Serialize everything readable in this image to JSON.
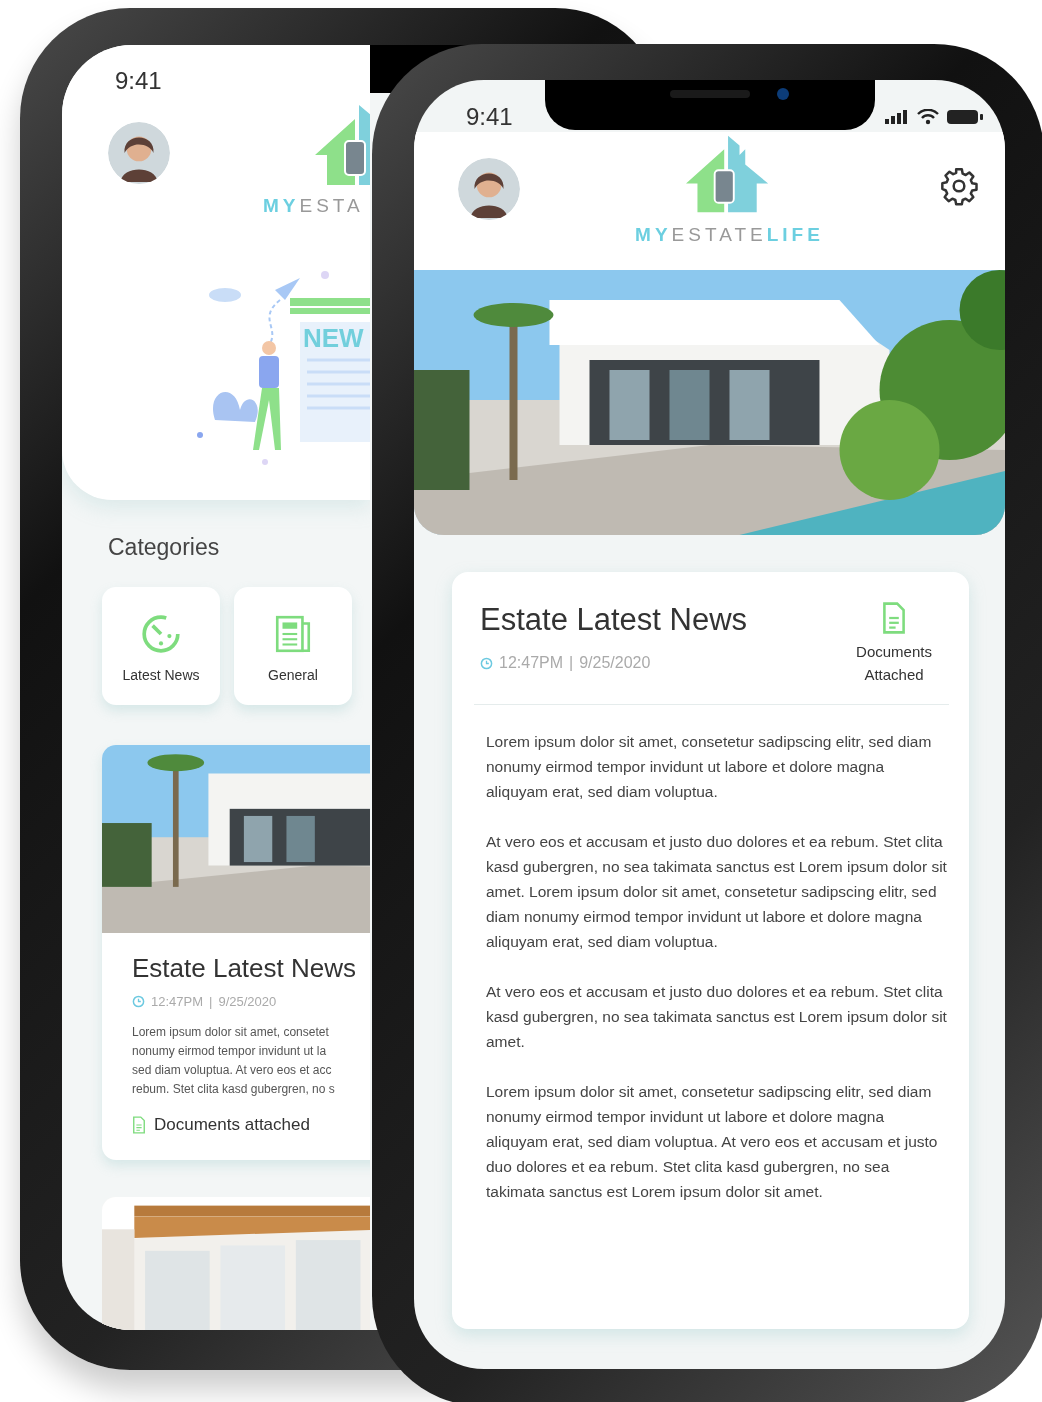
{
  "back_phone": {
    "status_bar": {
      "time": "9:41"
    },
    "logo": [
      {
        "text": "MY",
        "kind": "accent"
      },
      {
        "text": "ESTA",
        "kind": "plain"
      }
    ],
    "illustration": {
      "label": "NEW"
    },
    "categories": {
      "title": "Categories",
      "items": [
        {
          "label": "Latest News",
          "kind": "clock"
        },
        {
          "label": "General",
          "kind": "newspaper"
        }
      ]
    },
    "news_card": {
      "title": "Estate Latest News",
      "time": "12:47PM",
      "separator": "|",
      "date": "9/25/2020",
      "lines": [
        "Lorem ipsum dolor sit amet, consetet",
        "nonumy eirmod tempor invidunt ut la",
        "sed diam voluptua. At vero eos et acc",
        "rebum. Stet clita kasd gubergren, no s"
      ],
      "attachment": "Documents attached"
    }
  },
  "front_phone": {
    "status_bar": {
      "time": "9:41"
    },
    "logo": [
      {
        "text": "MY",
        "kind": "accent"
      },
      {
        "text": "ESTATE",
        "kind": "plain"
      },
      {
        "text": "LIFE",
        "kind": "accent"
      }
    ],
    "article": {
      "title": "Estate Latest News",
      "time": "12:47PM",
      "separator": "|",
      "date": "9/25/2020",
      "attachment": "Documents Attached",
      "paragraphs": [
        "Lorem ipsum dolor sit amet, consetetur sadipscing elitr, sed diam nonumy eirmod tempor invidunt ut labore et dolore magna aliquyam erat, sed diam voluptua.",
        "At vero eos et accusam et justo duo dolores et ea rebum. Stet clita kasd gubergren, no sea takimata sanctus est Lorem ipsum dolor sit amet. Lorem ipsum dolor sit amet, consetetur sadipscing elitr, sed diam nonumy eirmod tempor invidunt ut labore et dolore magna aliquyam erat, sed diam voluptua.",
        "At vero eos et accusam et justo duo dolores et ea rebum. Stet clita kasd gubergren, no sea takimata sanctus est Lorem ipsum dolor sit amet.",
        "Lorem ipsum dolor sit amet, consetetur sadipscing elitr, sed diam nonumy eirmod tempor invidunt ut labore et dolore magna aliquyam erat, sed diam voluptua. At vero eos et accusam et justo duo dolores et ea rebum. Stet clita kasd gubergren, no sea takimata sanctus est Lorem ipsum dolor sit amet."
      ]
    }
  }
}
